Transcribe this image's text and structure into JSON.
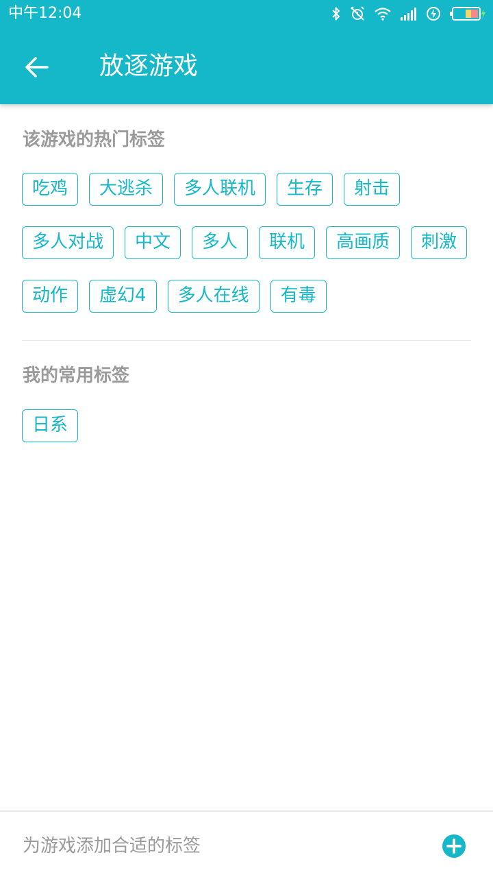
{
  "status_bar": {
    "time": "中午12:04",
    "icons": [
      "bluetooth-icon",
      "alarm-off-icon",
      "wifi-icon",
      "signal-icon",
      "charging-icon",
      "battery-icon"
    ]
  },
  "header": {
    "title": "放逐游戏",
    "back_icon": "arrow-left-icon"
  },
  "hot_tags": {
    "title": "该游戏的热门标签",
    "items": [
      "吃鸡",
      "大逃杀",
      "多人联机",
      "生存",
      "射击",
      "多人对战",
      "中文",
      "多人",
      "联机",
      "高画质",
      "刺激",
      "动作",
      "虚幻4",
      "多人在线",
      "有毒"
    ]
  },
  "my_tags": {
    "title": "我的常用标签",
    "items": [
      "日系"
    ]
  },
  "bottom": {
    "placeholder": "为游戏添加合适的标签",
    "add_icon": "plus-circle-icon"
  },
  "colors": {
    "accent": "#14b8c9",
    "muted_text": "#9a9a9a",
    "divider": "#e6e6e6"
  }
}
